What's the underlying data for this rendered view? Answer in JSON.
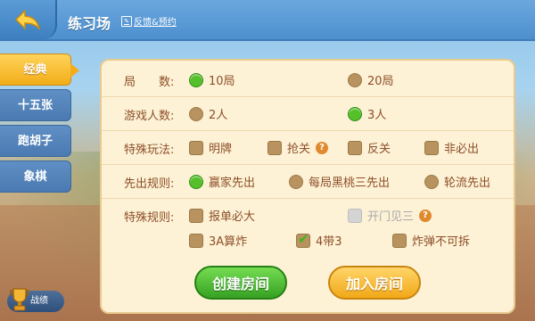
{
  "header": {
    "title": "练习场",
    "feedback_label": "反馈&预约"
  },
  "sidebar": {
    "items": [
      {
        "label": "经典",
        "active": true
      },
      {
        "label": "十五张",
        "active": false
      },
      {
        "label": "跑胡子",
        "active": false
      },
      {
        "label": "象棋",
        "active": false
      }
    ],
    "record_label": "战绩"
  },
  "settings": {
    "rounds": {
      "label": "局　　数:",
      "options": [
        "10局",
        "20局"
      ],
      "selected": "10局"
    },
    "players": {
      "label": "游戏人数:",
      "options": [
        "2人",
        "3人"
      ],
      "selected": "3人"
    },
    "special_play": {
      "label": "特殊玩法:",
      "options": [
        "明牌",
        "抢关",
        "反关",
        "非必出"
      ],
      "help_on": "抢关"
    },
    "first_play": {
      "label": "先出规则:",
      "options": [
        "赢家先出",
        "每局黑桃三先出",
        "轮流先出"
      ],
      "selected": "赢家先出"
    },
    "special_rules": {
      "label": "特殊规则:",
      "options": [
        "报单必大",
        "开门见三",
        "3A算炸",
        "4带3",
        "炸弹不可拆"
      ],
      "checked": [
        "4带3"
      ],
      "disabled": [
        "开门见三"
      ]
    }
  },
  "buttons": {
    "create": "创建房间",
    "join": "加入房间"
  },
  "colors": {
    "accent_green": "#56c02a",
    "accent_orange": "#f2ad18",
    "text_brown": "#8d4e28",
    "panel_bg": "#fdf2d6"
  }
}
